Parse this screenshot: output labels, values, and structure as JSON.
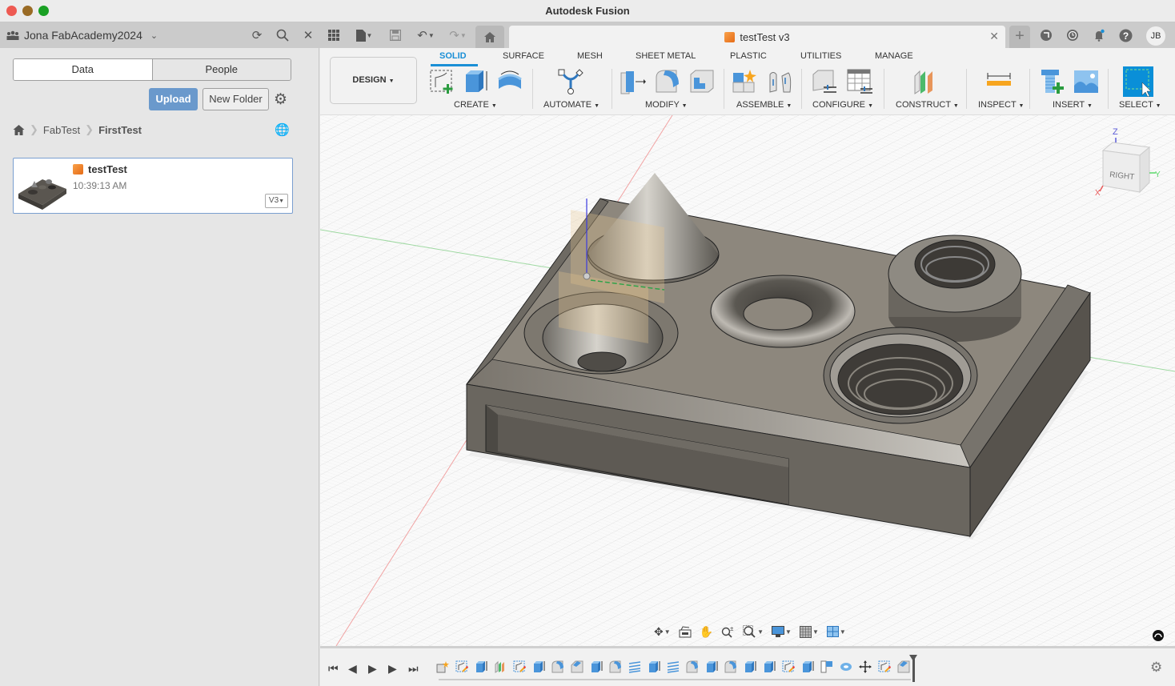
{
  "window": {
    "title": "Autodesk Fusion"
  },
  "topbar": {
    "team_name": "Jona FabAcademy2024",
    "icons": [
      "team-icon",
      "refresh-icon",
      "search-icon",
      "close-icon",
      "grid-icon",
      "file-icon",
      "save-icon",
      "undo-icon",
      "redo-icon",
      "home-icon"
    ],
    "document_tab": "testTest v3",
    "user_initials": "JB",
    "right_icons": [
      "add-tab-icon",
      "extensions-icon",
      "job-status-icon",
      "notifications-icon",
      "help-icon"
    ]
  },
  "data_panel": {
    "tabs": [
      {
        "label": "Data",
        "active": true
      },
      {
        "label": "People",
        "active": false
      }
    ],
    "upload_label": "Upload",
    "new_folder_label": "New Folder",
    "breadcrumb": [
      "FabTest",
      "FirstTest"
    ],
    "files": [
      {
        "name": "testTest",
        "time": "10:39:13 AM",
        "version": "V3"
      }
    ]
  },
  "ribbon": {
    "workspace": "DESIGN",
    "tabs": [
      {
        "label": "SOLID",
        "active": true
      },
      {
        "label": "SURFACE"
      },
      {
        "label": "MESH"
      },
      {
        "label": "SHEET METAL"
      },
      {
        "label": "PLASTIC"
      },
      {
        "label": "UTILITIES"
      },
      {
        "label": "MANAGE"
      }
    ],
    "groups": [
      "CREATE",
      "AUTOMATE",
      "MODIFY",
      "ASSEMBLE",
      "CONFIGURE",
      "CONSTRUCT",
      "INSPECT",
      "INSERT",
      "SELECT"
    ]
  },
  "viewcube": {
    "face": "RIGHT",
    "axes": {
      "x": "X",
      "y": "Y",
      "z": "Z"
    }
  },
  "colors": {
    "accent": "#1a8fd6",
    "upload": "#6a99cc",
    "model": "#8d877d"
  }
}
